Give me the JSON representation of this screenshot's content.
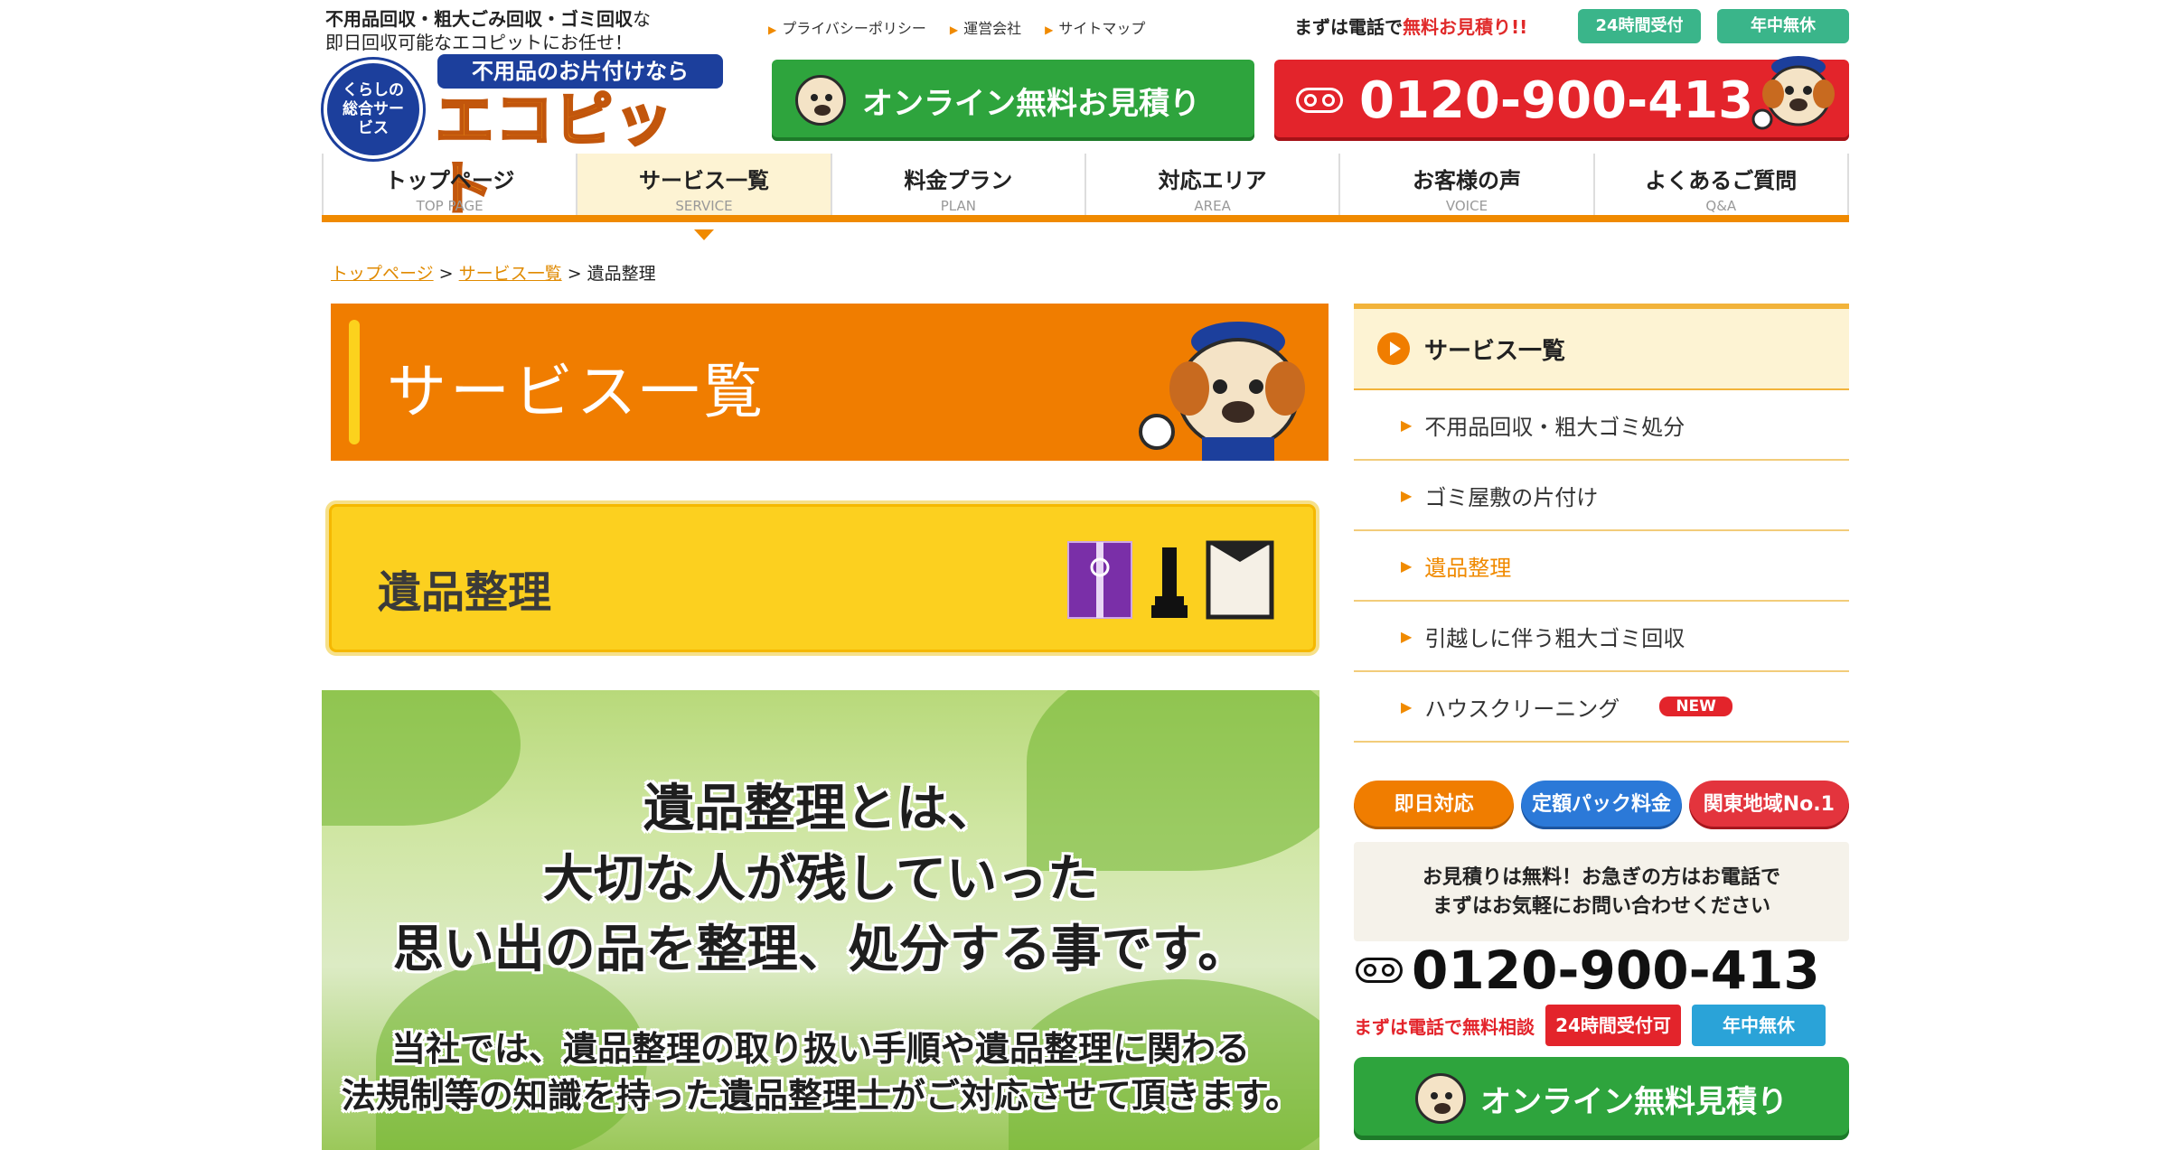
{
  "header": {
    "tagline_bold": "不用品回収・粗大ごみ回収・ゴミ回収",
    "tagline_suffix": "な",
    "tagline_line2": "即日回収可能なエコピットにお任せ！",
    "logo_circle": "くらしの総合サービス",
    "logo_badge": "不用品のお片付けなら",
    "logo_name": "エコピット",
    "top_links": [
      "プライバシーポリシー",
      "運営会社",
      "サイトマップ"
    ],
    "tel_note_prefix": "まずは電話で",
    "tel_note_red": "無料お見積り!!",
    "pill_24h": "24時間受付",
    "pill_open": "年中無休",
    "online_button": "オンライン無料お見積り",
    "phone": "0120-900-413"
  },
  "nav": [
    {
      "jp": "トップページ",
      "en": "TOP PAGE"
    },
    {
      "jp": "サービス一覧",
      "en": "SERVICE"
    },
    {
      "jp": "料金プラン",
      "en": "PLAN"
    },
    {
      "jp": "対応エリア",
      "en": "AREA"
    },
    {
      "jp": "お客様の声",
      "en": "VOICE"
    },
    {
      "jp": "よくあるご質問",
      "en": "Q&A"
    }
  ],
  "breadcrumb": {
    "home": "トップページ",
    "services": "サービス一覧",
    "current": "遺品整理",
    "sep": ">"
  },
  "page_title": "サービス一覧",
  "category": "遺品整理",
  "hero": {
    "line1": "遺品整理とは、",
    "line2": "大切な人が残していった",
    "line3": "思い出の品を整理、処分する事です。",
    "line4": "当社では、遺品整理の取り扱い手順や遺品整理に関わる",
    "line5": "法規制等の知識を持った遺品整理士がご対応させて頂きます。"
  },
  "sidebar": {
    "heading": "サービス一覧",
    "items": [
      {
        "label": "不用品回収・粗大ゴミ処分"
      },
      {
        "label": "ゴミ屋敷の片付け"
      },
      {
        "label": "遺品整理"
      },
      {
        "label": "引越しに伴う粗大ゴミ回収"
      },
      {
        "label": "ハウスクリーニング",
        "badge": "NEW"
      }
    ],
    "badges": [
      "即日対応",
      "定額パック料金",
      "関東地域No.1"
    ],
    "note_line1": "お見積りは無料！お急ぎの方はお電話で",
    "note_line2": "まずはお気軽にお問い合わせください",
    "phone": "0120-900-413",
    "tel_note": "まずは電話で無料相談",
    "mini_24h": "24時間受付可",
    "mini_open": "年中無休",
    "online_button": "オンライン無料見積り"
  }
}
